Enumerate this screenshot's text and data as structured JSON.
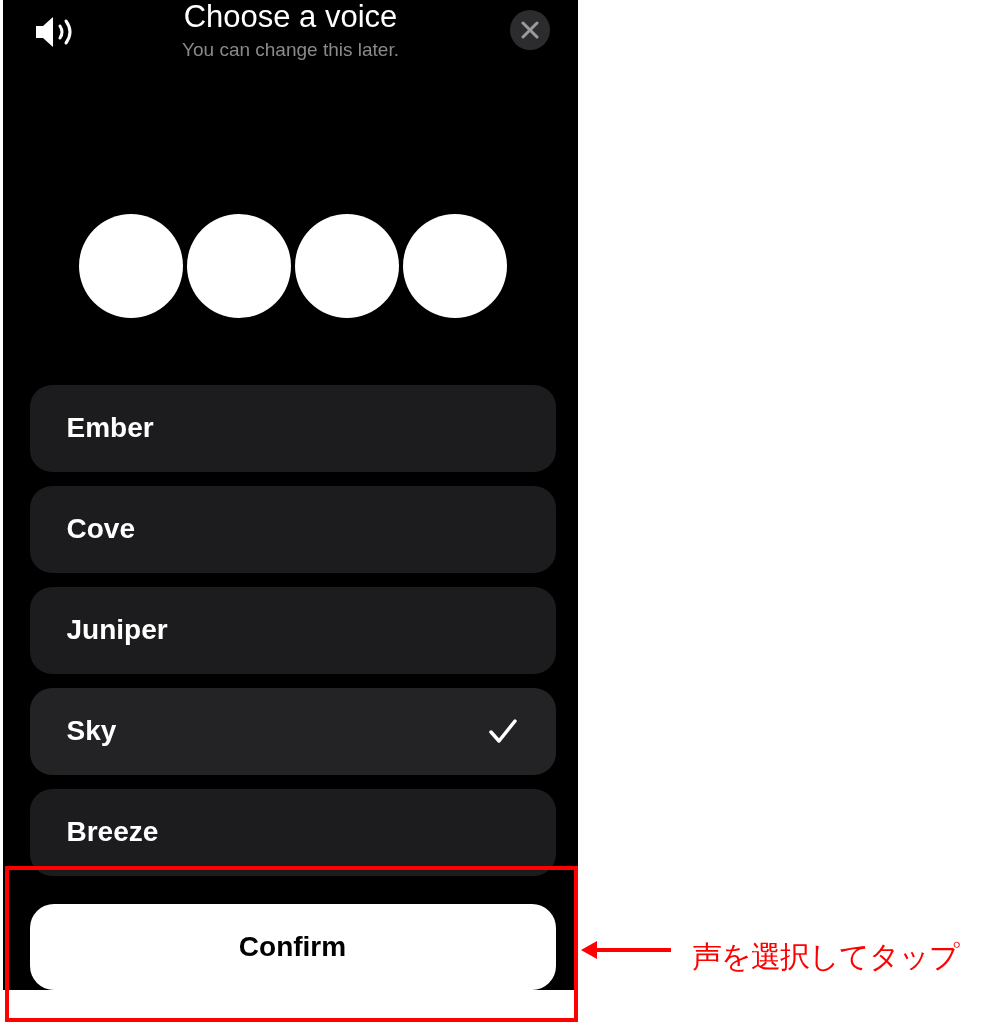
{
  "header": {
    "title": "Choose a voice",
    "subtitle": "You can change this later."
  },
  "voices": [
    {
      "name": "Ember",
      "selected": false
    },
    {
      "name": "Cove",
      "selected": false
    },
    {
      "name": "Juniper",
      "selected": false
    },
    {
      "name": "Sky",
      "selected": true
    },
    {
      "name": "Breeze",
      "selected": false
    }
  ],
  "confirm_button": {
    "label": "Confirm"
  },
  "annotation": {
    "text": "声を選択してタップ"
  }
}
